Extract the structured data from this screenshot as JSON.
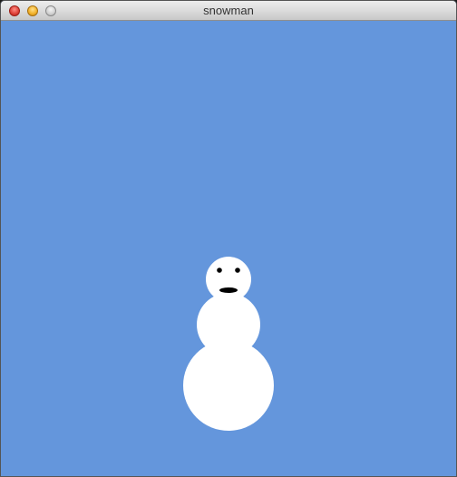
{
  "window": {
    "title": "snowman",
    "buttons": {
      "close_icon": "close-icon",
      "minimize_icon": "minimize-icon",
      "zoom_icon": "zoom-icon"
    }
  },
  "scene": {
    "background_color": "#6496dc",
    "snow_color": "#ffffff",
    "face_color": "#000000"
  }
}
